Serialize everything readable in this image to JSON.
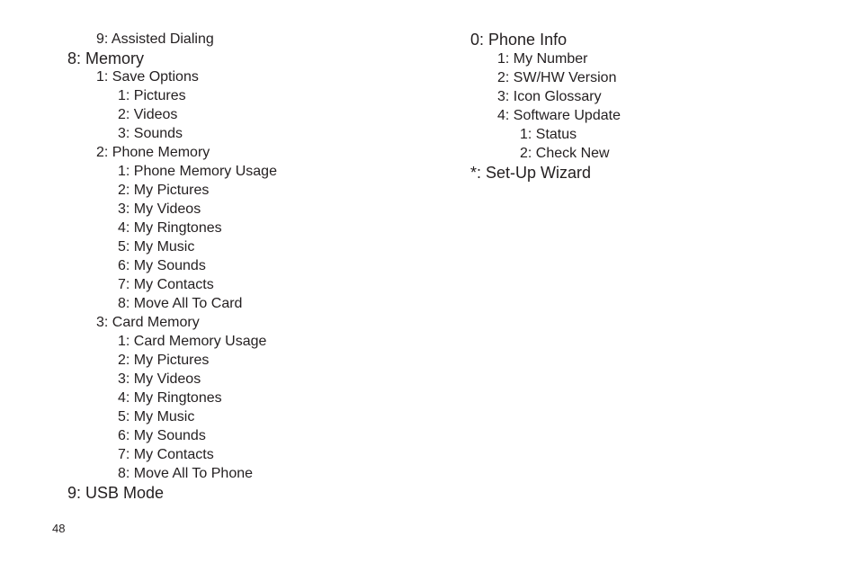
{
  "left_column": [
    {
      "level": 2,
      "text": "9: Assisted Dialing"
    },
    {
      "level": 1,
      "text": "8: Memory"
    },
    {
      "level": 2,
      "text": "1: Save Options"
    },
    {
      "level": 3,
      "text": "1: Pictures"
    },
    {
      "level": 3,
      "text": "2: Videos"
    },
    {
      "level": 3,
      "text": "3: Sounds"
    },
    {
      "level": 2,
      "text": "2: Phone Memory"
    },
    {
      "level": 3,
      "text": "1: Phone Memory Usage"
    },
    {
      "level": 3,
      "text": "2: My Pictures"
    },
    {
      "level": 3,
      "text": "3: My Videos"
    },
    {
      "level": 3,
      "text": "4: My Ringtones"
    },
    {
      "level": 3,
      "text": "5: My Music"
    },
    {
      "level": 3,
      "text": "6: My Sounds"
    },
    {
      "level": 3,
      "text": "7: My Contacts"
    },
    {
      "level": 3,
      "text": "8: Move All To Card"
    },
    {
      "level": 2,
      "text": "3: Card Memory"
    },
    {
      "level": 3,
      "text": "1: Card Memory Usage"
    },
    {
      "level": 3,
      "text": "2: My Pictures"
    },
    {
      "level": 3,
      "text": "3: My Videos"
    },
    {
      "level": 3,
      "text": "4: My Ringtones"
    },
    {
      "level": 3,
      "text": "5: My Music"
    },
    {
      "level": 3,
      "text": "6: My Sounds"
    },
    {
      "level": 3,
      "text": "7: My Contacts"
    },
    {
      "level": 3,
      "text": "8: Move All To Phone"
    },
    {
      "level": 1,
      "text": "9: USB Mode"
    }
  ],
  "right_column": [
    {
      "level": 1,
      "text": "0: Phone Info"
    },
    {
      "level": 2,
      "text": "1: My Number"
    },
    {
      "level": 2,
      "text": "2: SW/HW Version"
    },
    {
      "level": 2,
      "text": "3: Icon Glossary"
    },
    {
      "level": 2,
      "text": "4: Software Update"
    },
    {
      "level": 3,
      "text": "1: Status"
    },
    {
      "level": 3,
      "text": "2: Check New"
    },
    {
      "level": 1,
      "text": "*: Set-Up Wizard"
    }
  ],
  "page_number": "48"
}
